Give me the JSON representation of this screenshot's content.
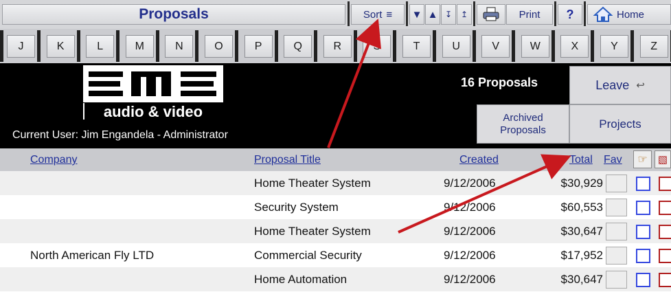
{
  "toolbar": {
    "title": "Proposals",
    "sort_label": "Sort",
    "print_label": "Print",
    "help_label": "?",
    "home_label": "Home"
  },
  "alphabet": [
    "J",
    "K",
    "L",
    "M",
    "N",
    "O",
    "P",
    "Q",
    "R",
    "S",
    "T",
    "U",
    "V",
    "W",
    "X",
    "Y",
    "Z"
  ],
  "header": {
    "logo_text": "audio & video",
    "logo_mark": "EME",
    "current_user": "Current User: Jim Engandela - Administrator",
    "proposal_count": "16 Proposals",
    "leave_label": "Leave",
    "archived_label": "Archived Proposals",
    "projects_label": "Projects"
  },
  "columns": {
    "company": "Company",
    "title": "Proposal Title",
    "created": "Created",
    "total": "Total",
    "fav": "Fav"
  },
  "rows": [
    {
      "company": "",
      "title": "Home Theater System",
      "created": "9/12/2006",
      "total": "$30,929"
    },
    {
      "company": "",
      "title": "Security System",
      "created": "9/12/2006",
      "total": "$60,553"
    },
    {
      "company": "",
      "title": "Home Theater System",
      "created": "9/12/2006",
      "total": "$30,647"
    },
    {
      "company": "North American Fly LTD",
      "title": "Commercial Security",
      "created": "9/12/2006",
      "total": "$17,952"
    },
    {
      "company": "",
      "title": "Home Automation",
      "created": "9/12/2006",
      "total": "$30,647"
    }
  ],
  "colors": {
    "arrow": "#c8191e",
    "link": "#1f2f9a",
    "row_alt": "#efefef"
  }
}
